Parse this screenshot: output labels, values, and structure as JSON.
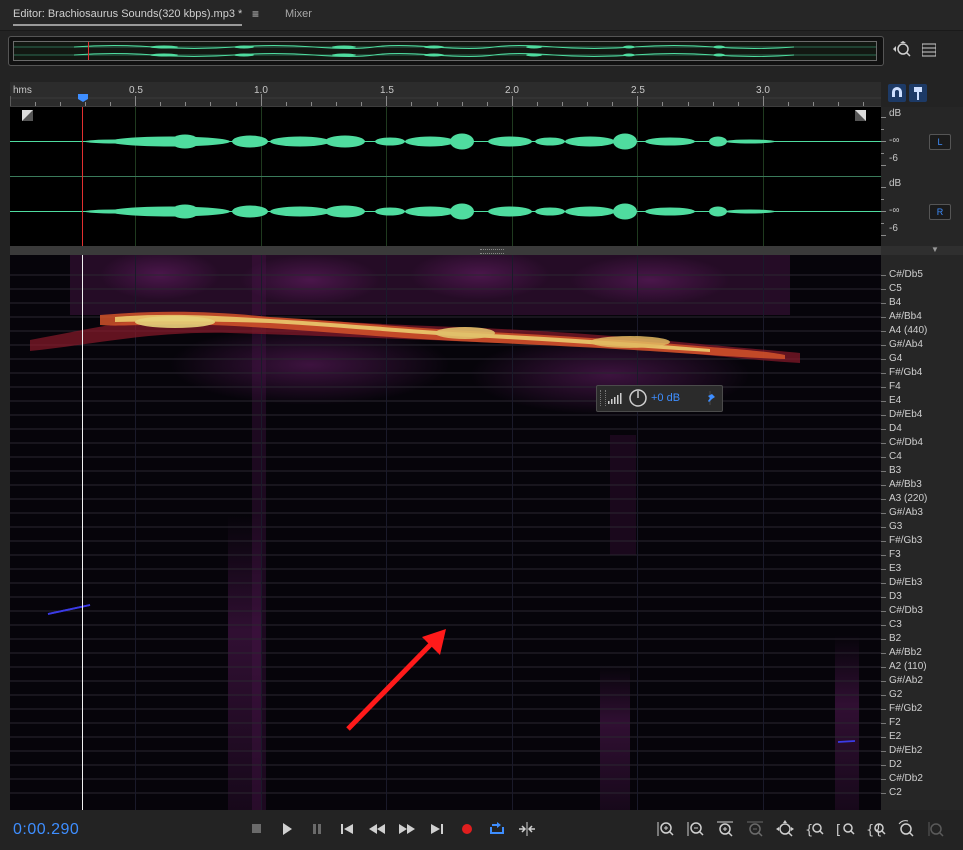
{
  "tabs": {
    "editor_label": "Editor: Brachiosaurus Sounds(320  kbps).mp3 *",
    "menu_icon": "menu-icon",
    "mixer_label": "Mixer"
  },
  "ruler": {
    "units": "hms",
    "ticks": [
      "0.5",
      "1.0",
      "1.5",
      "2.0",
      "2.5",
      "3.0"
    ]
  },
  "channels": {
    "db_label": "dB",
    "inf_label": "-∞",
    "minus6_label": "-6",
    "left_label": "L",
    "right_label": "R"
  },
  "pitch_notes": [
    "C#/Db5",
    "C5",
    "B4",
    "A#/Bb4",
    "A4 (440)",
    "G#/Ab4",
    "G4",
    "F#/Gb4",
    "F4",
    "E4",
    "D#/Eb4",
    "D4",
    "C#/Db4",
    "C4",
    "B3",
    "A#/Bb3",
    "A3 (220)",
    "G#/Ab3",
    "G3",
    "F#/Gb3",
    "F3",
    "E3",
    "D#/Eb3",
    "D3",
    "C#/Db3",
    "C3",
    "B2",
    "A#/Bb2",
    "A2 (110)",
    "G#/Ab2",
    "G2",
    "F#/Gb2",
    "F2",
    "E2",
    "D#/Eb2",
    "D2",
    "C#/Db2",
    "C2"
  ],
  "hud": {
    "gain_label": "+0 dB"
  },
  "transport": {
    "time": "0:00.290"
  },
  "colors": {
    "accent": "#3e8eff",
    "waveform": "#4fdc9f",
    "pitch_line": "#3b3be6",
    "playhead": "#e23030",
    "annotation_arrow": "#ff1a1a"
  }
}
